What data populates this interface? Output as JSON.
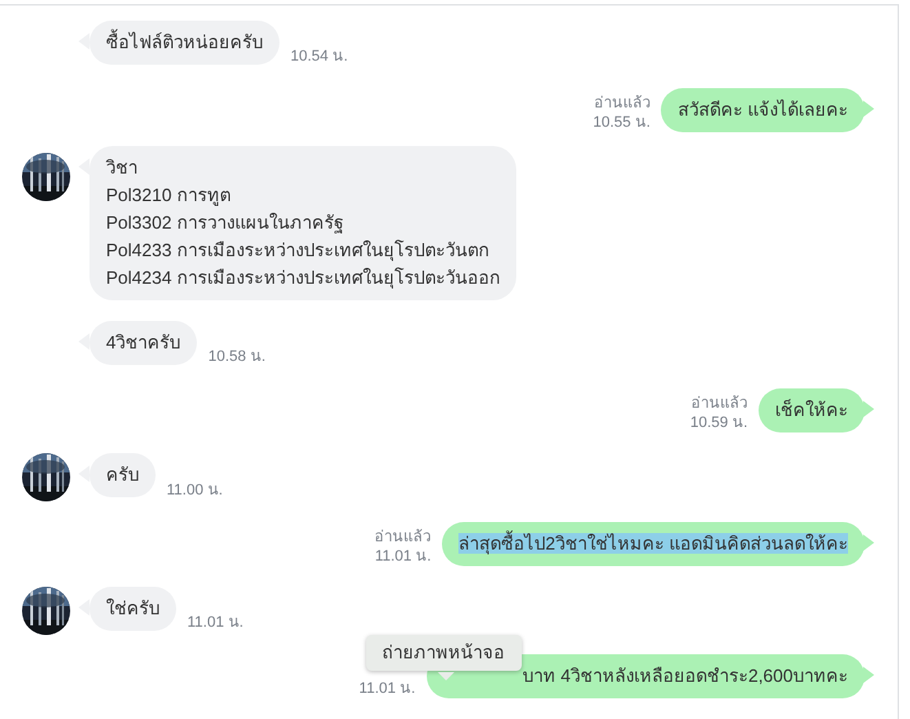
{
  "messages": [
    {
      "kind": "incoming",
      "avatar": false,
      "text": "ซื้อไฟล์ติวหน่อยครับ",
      "time": "10.54 น."
    },
    {
      "kind": "outgoing",
      "read_label": "อ่านแล้ว",
      "text": "สวัสดีคะ แจ้งได้เลยคะ",
      "time": "10.55 น.",
      "highlighted": false
    },
    {
      "kind": "incoming",
      "avatar": true,
      "text": "วิชา\nPol3210 การทูต\nPol3302 การวางแผนในภาครัฐ\nPol4233 การเมืองระหว่างประเทศในยุโรปตะวันตก\nPol4234 การเมืองระหว่างประเทศในยุโรปตะวันออก"
    },
    {
      "kind": "incoming",
      "avatar": false,
      "text": "4วิชาครับ",
      "time": "10.58 น."
    },
    {
      "kind": "outgoing",
      "read_label": "อ่านแล้ว",
      "text": "เช็คให้คะ",
      "time": "10.59 น.",
      "highlighted": false
    },
    {
      "kind": "incoming",
      "avatar": true,
      "text": "ครับ",
      "time": "11.00 น."
    },
    {
      "kind": "outgoing",
      "read_label": "อ่านแล้ว",
      "text": "ล่าสุดซื้อไป2วิชาใช่ไหมคะ แอดมินคิดส่วนลดให้คะ",
      "time": "11.01 น.",
      "highlighted": true
    },
    {
      "kind": "incoming",
      "avatar": true,
      "text": "ใช่ครับ",
      "time": "11.01 น."
    },
    {
      "kind": "outgoing",
      "text": "บาท 4วิชาหลังเหลือยอดชำระ2,600บาทคะ",
      "time": "11.01 น.",
      "highlighted": false,
      "tooltip": "ถ่ายภาพหน้าจอ"
    }
  ]
}
